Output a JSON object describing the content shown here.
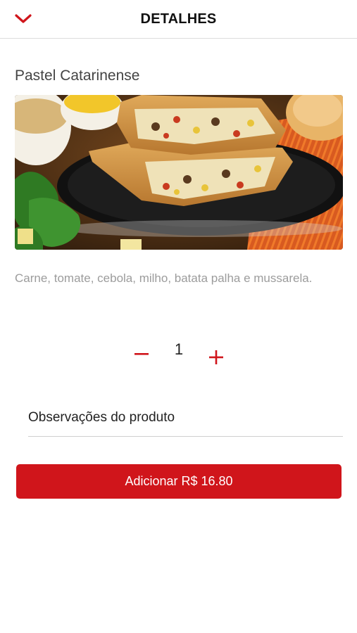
{
  "header": {
    "title": "DETALHES",
    "back_icon": "chevron-down-icon"
  },
  "product": {
    "name": "Pastel Catarinense",
    "image_alt": "pastel-photo",
    "description": "Carne, tomate, cebola, milho, batata palha e mussarela."
  },
  "quantity": {
    "minus_label": "−",
    "value": "1",
    "plus_label": "+"
  },
  "notes": {
    "placeholder": "Observações do produto"
  },
  "add_button": {
    "label": "Adicionar R$ 16.80"
  },
  "colors": {
    "accent": "#d0151b"
  }
}
